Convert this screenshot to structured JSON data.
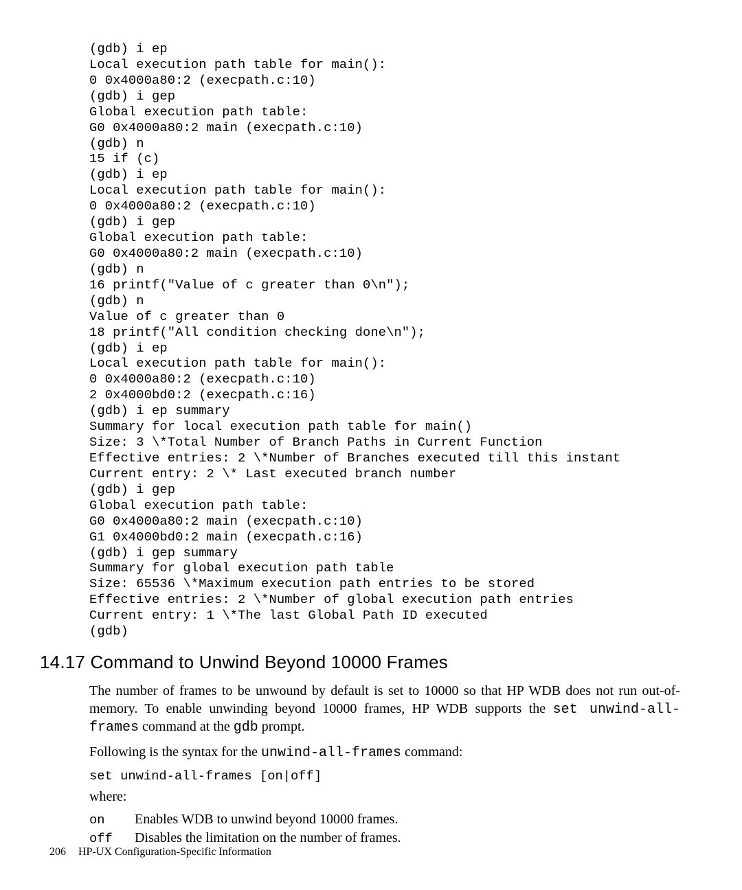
{
  "code": "(gdb) i ep\nLocal execution path table for main():\n0 0x4000a80:2 (execpath.c:10)\n(gdb) i gep\nGlobal execution path table:\nG0 0x4000a80:2 main (execpath.c:10)\n(gdb) n\n15 if (c)\n(gdb) i ep\nLocal execution path table for main():\n0 0x4000a80:2 (execpath.c:10)\n(gdb) i gep\nGlobal execution path table:\nG0 0x4000a80:2 main (execpath.c:10)\n(gdb) n\n16 printf(\"Value of c greater than 0\\n\");\n(gdb) n\nValue of c greater than 0\n18 printf(\"All condition checking done\\n\");\n(gdb) i ep\nLocal execution path table for main():\n0 0x4000a80:2 (execpath.c:10)\n2 0x4000bd0:2 (execpath.c:16)\n(gdb) i ep summary\nSummary for local execution path table for main()\nSize: 3 \\*Total Number of Branch Paths in Current Function\nEffective entries: 2 \\*Number of Branches executed till this instant\nCurrent entry: 2 \\* Last executed branch number\n(gdb) i gep\nGlobal execution path table:\nG0 0x4000a80:2 main (execpath.c:10)\nG1 0x4000bd0:2 main (execpath.c:16)\n(gdb) i gep summary\nSummary for global execution path table\nSize: 65536 \\*Maximum execution path entries to be stored\nEffective entries: 2 \\*Number of global execution path entries\nCurrent entry: 1 \\*The last Global Path ID executed\n(gdb)",
  "heading": "14.17 Command to Unwind Beyond 10000 Frames",
  "para1_a": "The number of frames to be unwound by default is set to 10000 so that HP WDB does not run out-of-memory. To enable unwinding beyond 10000 frames, HP WDB supports the ",
  "para1_cmd": "set unwind-all-frames",
  "para1_b": " command at the ",
  "para1_prompt": "gdb",
  "para1_c": " prompt.",
  "para2_a": "Following is the syntax for the ",
  "para2_cmd": "unwind-all-frames",
  "para2_b": " command:",
  "syntax": "set unwind-all-frames [on|off]",
  "where": "where:",
  "defs": {
    "on": {
      "term": "on",
      "desc": "Enables WDB to unwind beyond 10000 frames."
    },
    "off": {
      "term": "off",
      "desc": "Disables the limitation on the number of frames."
    }
  },
  "footer": {
    "pagenum": "206",
    "title": "HP-UX Configuration-Specific Information"
  }
}
